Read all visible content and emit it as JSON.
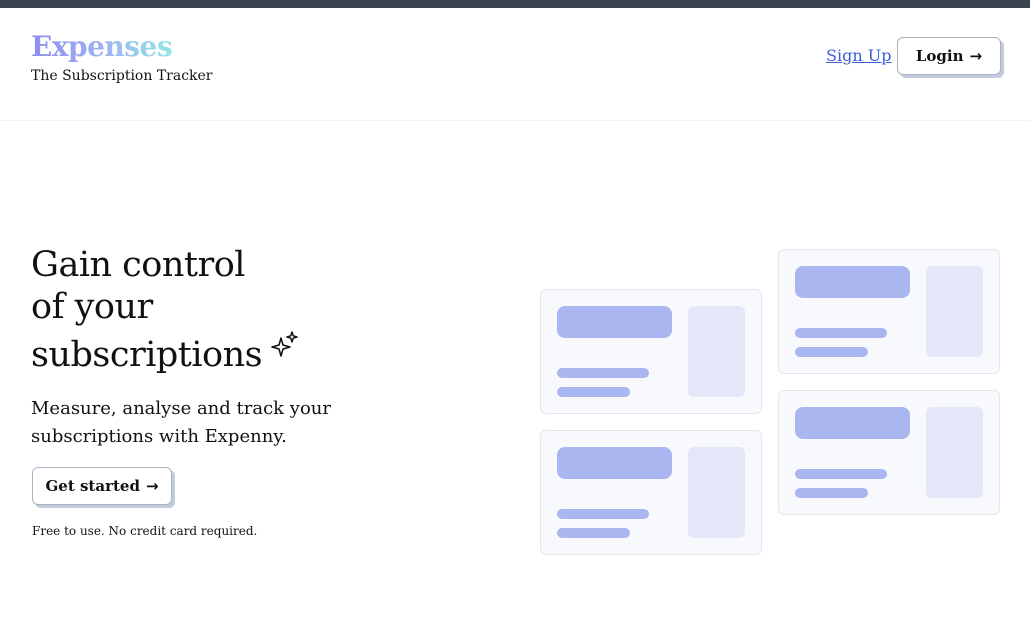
{
  "header": {
    "logo": "Expenses",
    "tagline": "The Subscription Tracker",
    "signup_label": "Sign Up",
    "login_label": "Login",
    "login_icon": "arrow-right-icon"
  },
  "hero": {
    "headline_line1": "Gain control",
    "headline_line2": "of your",
    "headline_line3": "subscriptions",
    "sparkle_icon": "sparkles-icon",
    "subhead": "Measure, analyse and track your subscriptions with Expenny.",
    "cta_label": "Get started",
    "cta_icon": "arrow-right-icon",
    "note": "Free to use. No credit card required."
  },
  "colors": {
    "topbar": "#3b4550",
    "link": "#3b5bdb",
    "skeleton_bar": "#a9b6f0",
    "skeleton_side": "#e3e7f8",
    "card_bg": "#f8f9fc"
  }
}
